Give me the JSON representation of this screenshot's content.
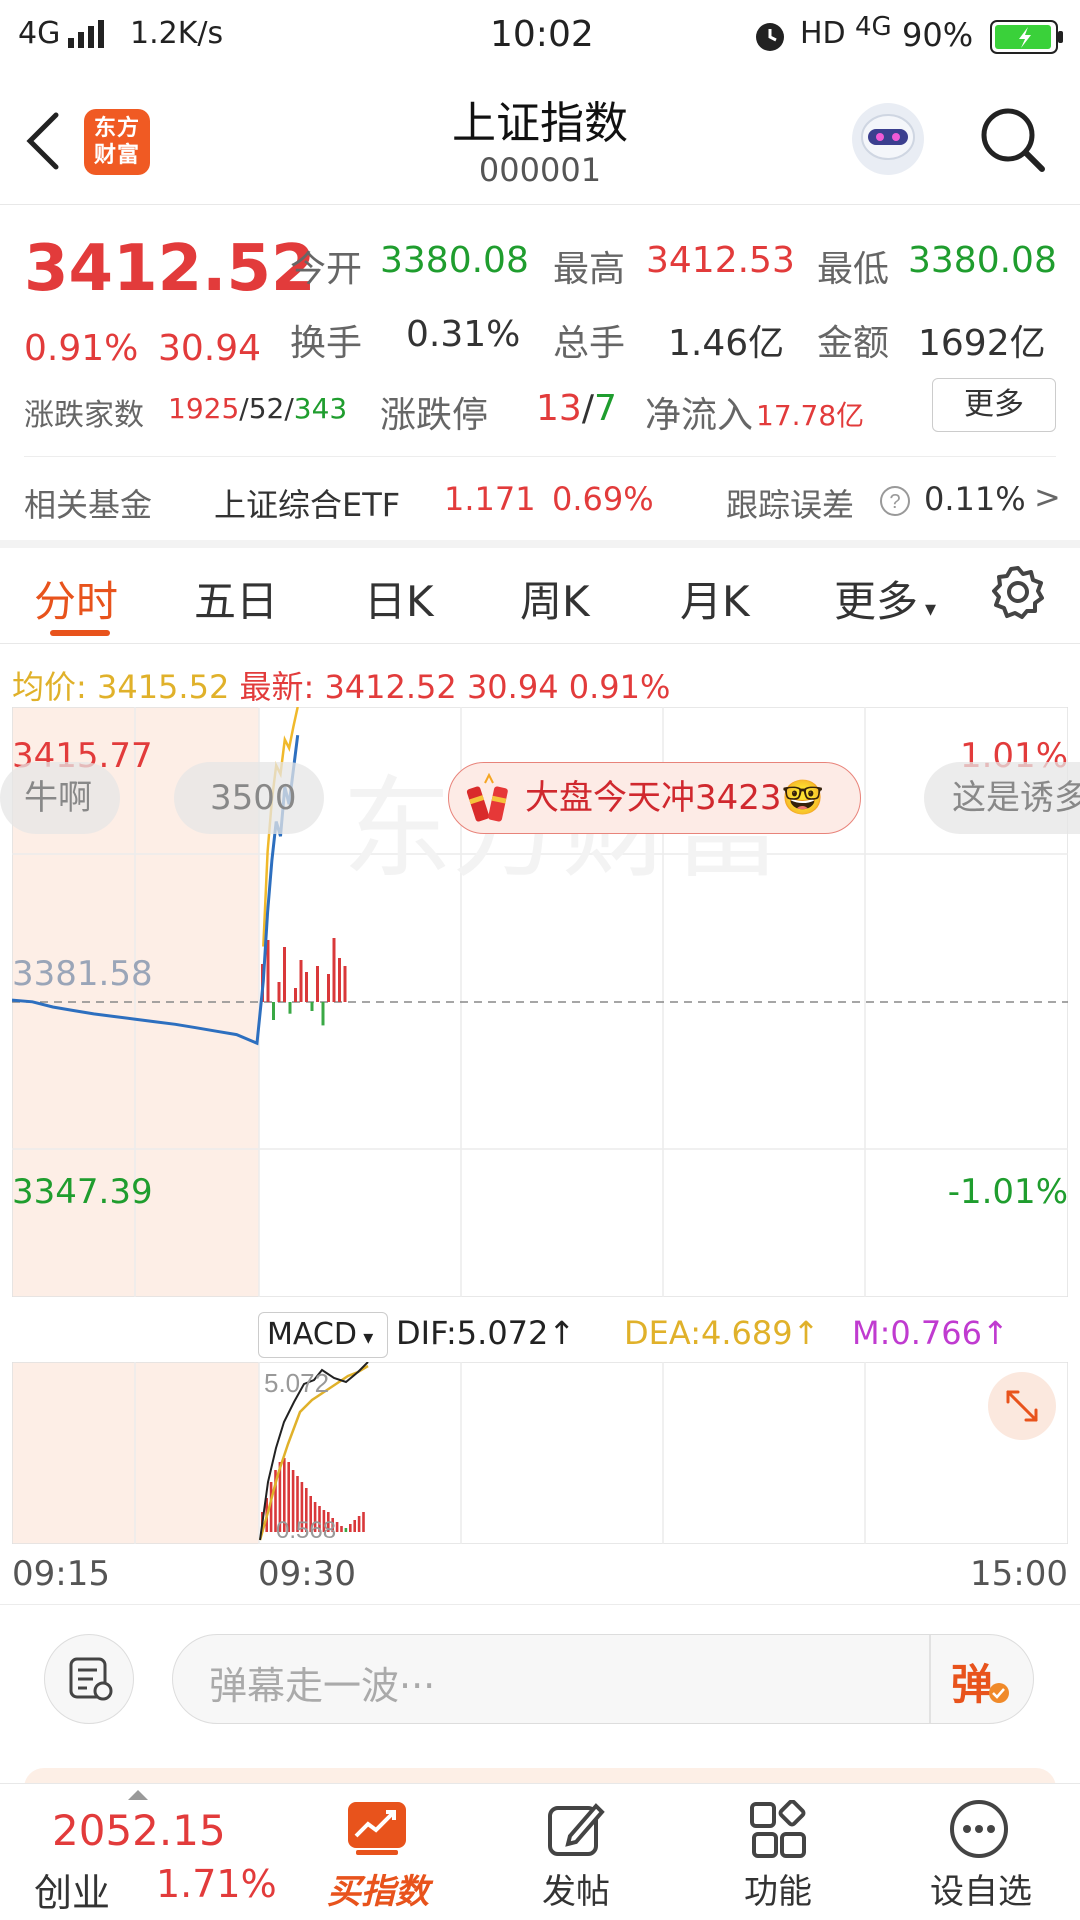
{
  "status_bar": {
    "network": "4G",
    "speed": "1.2K/s",
    "time": "10:02",
    "hd": "HD",
    "net2": "4G",
    "battery": "90%"
  },
  "nav": {
    "logo_line1": "东方",
    "logo_line2": "财富",
    "title": "上证指数",
    "code": "000001"
  },
  "quote": {
    "price": "3412.52",
    "change_pct": "0.91%",
    "change": "30.94",
    "open_label": "今开",
    "open": "3380.08",
    "high_label": "最高",
    "high": "3412.53",
    "low_label": "最低",
    "low": "3380.08",
    "turnover_label": "换手",
    "turnover": "0.31%",
    "volume_label": "总手",
    "volume": "1.46亿",
    "amount_label": "金额",
    "amount": "1692亿",
    "adv_dec_label": "涨跌家数",
    "adv": "1925",
    "flat": "52",
    "dec": "343",
    "limit_label": "涨跌停",
    "limit_up": "13",
    "limit_down": "7",
    "inflow_label": "净流入",
    "inflow": "17.78亿",
    "more_button": "更多"
  },
  "fund": {
    "label": "相关基金",
    "name": "上证综合ETF",
    "price": "1.171",
    "pct": "0.69%",
    "tracking_label": "跟踪误差",
    "tracking": "0.11%",
    "arrow": ">"
  },
  "tabs": [
    "分时",
    "五日",
    "日K",
    "周K",
    "月K",
    "更多"
  ],
  "chart_info": {
    "avg_label": "均价:",
    "avg": "3415.52",
    "latest_label": "最新:",
    "latest": "3412.52",
    "latest_change": "30.94",
    "latest_pct": "0.91%"
  },
  "chart_data": {
    "type": "line",
    "y_top": "3415.77",
    "y_mid": "3381.58",
    "y_bottom": "3347.39",
    "pct_top": "1.01%",
    "pct_bottom": "-1.01%",
    "x_labels": [
      "09:15",
      "09:30",
      "15:00"
    ],
    "ylim": [
      3347.39,
      3415.77
    ],
    "series": [
      {
        "values": [
          3381.8,
          3381.6,
          3381.0,
          3380.6,
          3380.2,
          3379.9,
          3379.6,
          3379.3,
          3379.0,
          3378.6,
          3378.2,
          3377.8,
          3376.8,
          3384.0,
          3392.0,
          3398.0,
          3402.5,
          3400.8,
          3406.5,
          3404.5,
          3408.5,
          3412.5
        ]
      },
      {
        "values": [
          null,
          null,
          null,
          null,
          null,
          null,
          null,
          null,
          null,
          null,
          null,
          null,
          null,
          3388.0,
          3399.0,
          3405.0,
          3409.0,
          3408.0,
          3412.0,
          3411.0,
          3413.5,
          3415.77
        ]
      }
    ],
    "watermark": "东方财富"
  },
  "danmaku": [
    "牛啊",
    "3500",
    "大盘今天冲3423🤓",
    "这是诱多"
  ],
  "macd": {
    "selector": "MACD",
    "dif": "DIF:5.072↑",
    "dea": "DEA:4.689↑",
    "m": "M:0.766↑",
    "top_value": "5.072",
    "bottom_value": "0.568"
  },
  "comment": {
    "placeholder": "弹幕走一波···",
    "send": "弹"
  },
  "bottom": {
    "index_value": "2052.15",
    "index_name": "创业",
    "index_pct": "1.71%",
    "buy_label": "买指数",
    "post_label": "发帖",
    "func_label": "功能",
    "watch_label": "设自选"
  }
}
